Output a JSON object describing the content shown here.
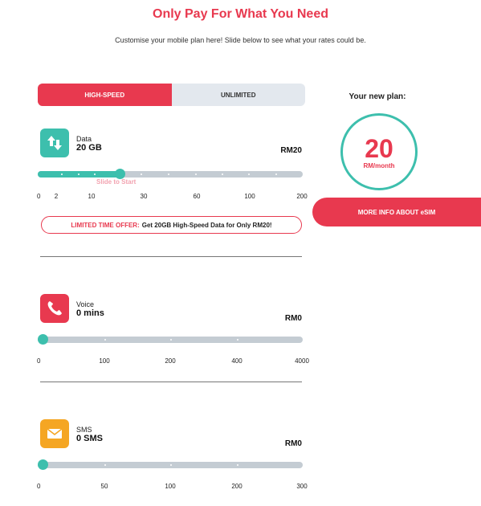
{
  "header": {
    "title": "Only Pay For What You Need",
    "subtitle": "Customise your mobile plan here! Slide below to see what your rates could be."
  },
  "tabs": [
    {
      "label": "HIGH-SPEED",
      "active": true
    },
    {
      "label": "UNLIMITED",
      "active": false
    }
  ],
  "data_section": {
    "label": "Data",
    "value": "20 GB",
    "price": "RM20",
    "hint": "Slide to Start",
    "ticks": [
      "0",
      "2",
      "10",
      "30",
      "60",
      "100",
      "200"
    ],
    "slider_fraction": 0.31,
    "icon": "data-arrows-icon",
    "icon_color": "#3dbfad"
  },
  "offer": {
    "highlight": "LIMITED TIME OFFER:",
    "text": "Get 20GB High-Speed Data for Only RM20!"
  },
  "voice_section": {
    "label": "Voice",
    "value": "0 mins",
    "price": "RM0",
    "ticks": [
      "0",
      "100",
      "200",
      "400",
      "4000"
    ],
    "slider_fraction": 0,
    "icon": "phone-icon",
    "icon_color": "#e8394f"
  },
  "sms_section": {
    "label": "SMS",
    "value": "0 SMS",
    "price": "RM0",
    "ticks": [
      "0",
      "50",
      "100",
      "200",
      "300"
    ],
    "slider_fraction": 0,
    "icon": "envelope-icon",
    "icon_color": "#f5a623"
  },
  "plan": {
    "label": "Your new plan:",
    "amount": "20",
    "unit": "RM/month"
  },
  "more_info": {
    "label": "MORE INFO ABOUT eSIM"
  },
  "colors": {
    "accent": "#e8394f",
    "teal": "#3dbfad",
    "track": "#c4ccd3"
  }
}
